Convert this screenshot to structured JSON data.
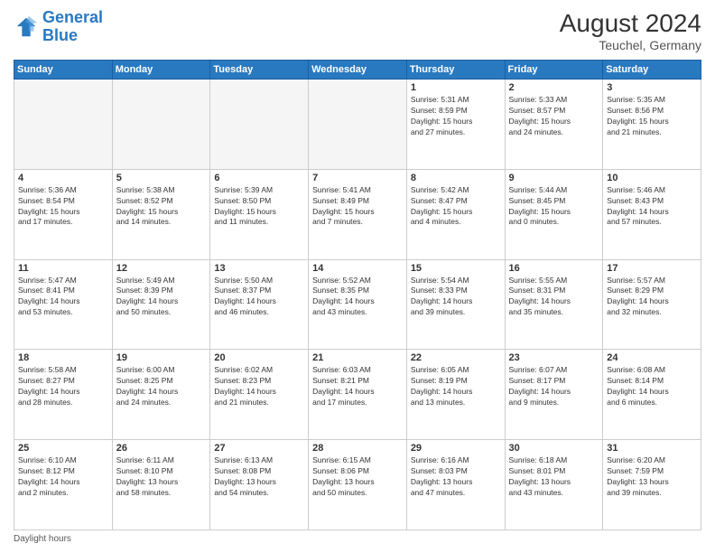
{
  "header": {
    "logo_line1": "General",
    "logo_line2": "Blue",
    "month_year": "August 2024",
    "location": "Teuchel, Germany"
  },
  "weekdays": [
    "Sunday",
    "Monday",
    "Tuesday",
    "Wednesday",
    "Thursday",
    "Friday",
    "Saturday"
  ],
  "weeks": [
    [
      {
        "day": "",
        "info": ""
      },
      {
        "day": "",
        "info": ""
      },
      {
        "day": "",
        "info": ""
      },
      {
        "day": "",
        "info": ""
      },
      {
        "day": "1",
        "info": "Sunrise: 5:31 AM\nSunset: 8:59 PM\nDaylight: 15 hours\nand 27 minutes."
      },
      {
        "day": "2",
        "info": "Sunrise: 5:33 AM\nSunset: 8:57 PM\nDaylight: 15 hours\nand 24 minutes."
      },
      {
        "day": "3",
        "info": "Sunrise: 5:35 AM\nSunset: 8:56 PM\nDaylight: 15 hours\nand 21 minutes."
      }
    ],
    [
      {
        "day": "4",
        "info": "Sunrise: 5:36 AM\nSunset: 8:54 PM\nDaylight: 15 hours\nand 17 minutes."
      },
      {
        "day": "5",
        "info": "Sunrise: 5:38 AM\nSunset: 8:52 PM\nDaylight: 15 hours\nand 14 minutes."
      },
      {
        "day": "6",
        "info": "Sunrise: 5:39 AM\nSunset: 8:50 PM\nDaylight: 15 hours\nand 11 minutes."
      },
      {
        "day": "7",
        "info": "Sunrise: 5:41 AM\nSunset: 8:49 PM\nDaylight: 15 hours\nand 7 minutes."
      },
      {
        "day": "8",
        "info": "Sunrise: 5:42 AM\nSunset: 8:47 PM\nDaylight: 15 hours\nand 4 minutes."
      },
      {
        "day": "9",
        "info": "Sunrise: 5:44 AM\nSunset: 8:45 PM\nDaylight: 15 hours\nand 0 minutes."
      },
      {
        "day": "10",
        "info": "Sunrise: 5:46 AM\nSunset: 8:43 PM\nDaylight: 14 hours\nand 57 minutes."
      }
    ],
    [
      {
        "day": "11",
        "info": "Sunrise: 5:47 AM\nSunset: 8:41 PM\nDaylight: 14 hours\nand 53 minutes."
      },
      {
        "day": "12",
        "info": "Sunrise: 5:49 AM\nSunset: 8:39 PM\nDaylight: 14 hours\nand 50 minutes."
      },
      {
        "day": "13",
        "info": "Sunrise: 5:50 AM\nSunset: 8:37 PM\nDaylight: 14 hours\nand 46 minutes."
      },
      {
        "day": "14",
        "info": "Sunrise: 5:52 AM\nSunset: 8:35 PM\nDaylight: 14 hours\nand 43 minutes."
      },
      {
        "day": "15",
        "info": "Sunrise: 5:54 AM\nSunset: 8:33 PM\nDaylight: 14 hours\nand 39 minutes."
      },
      {
        "day": "16",
        "info": "Sunrise: 5:55 AM\nSunset: 8:31 PM\nDaylight: 14 hours\nand 35 minutes."
      },
      {
        "day": "17",
        "info": "Sunrise: 5:57 AM\nSunset: 8:29 PM\nDaylight: 14 hours\nand 32 minutes."
      }
    ],
    [
      {
        "day": "18",
        "info": "Sunrise: 5:58 AM\nSunset: 8:27 PM\nDaylight: 14 hours\nand 28 minutes."
      },
      {
        "day": "19",
        "info": "Sunrise: 6:00 AM\nSunset: 8:25 PM\nDaylight: 14 hours\nand 24 minutes."
      },
      {
        "day": "20",
        "info": "Sunrise: 6:02 AM\nSunset: 8:23 PM\nDaylight: 14 hours\nand 21 minutes."
      },
      {
        "day": "21",
        "info": "Sunrise: 6:03 AM\nSunset: 8:21 PM\nDaylight: 14 hours\nand 17 minutes."
      },
      {
        "day": "22",
        "info": "Sunrise: 6:05 AM\nSunset: 8:19 PM\nDaylight: 14 hours\nand 13 minutes."
      },
      {
        "day": "23",
        "info": "Sunrise: 6:07 AM\nSunset: 8:17 PM\nDaylight: 14 hours\nand 9 minutes."
      },
      {
        "day": "24",
        "info": "Sunrise: 6:08 AM\nSunset: 8:14 PM\nDaylight: 14 hours\nand 6 minutes."
      }
    ],
    [
      {
        "day": "25",
        "info": "Sunrise: 6:10 AM\nSunset: 8:12 PM\nDaylight: 14 hours\nand 2 minutes."
      },
      {
        "day": "26",
        "info": "Sunrise: 6:11 AM\nSunset: 8:10 PM\nDaylight: 13 hours\nand 58 minutes."
      },
      {
        "day": "27",
        "info": "Sunrise: 6:13 AM\nSunset: 8:08 PM\nDaylight: 13 hours\nand 54 minutes."
      },
      {
        "day": "28",
        "info": "Sunrise: 6:15 AM\nSunset: 8:06 PM\nDaylight: 13 hours\nand 50 minutes."
      },
      {
        "day": "29",
        "info": "Sunrise: 6:16 AM\nSunset: 8:03 PM\nDaylight: 13 hours\nand 47 minutes."
      },
      {
        "day": "30",
        "info": "Sunrise: 6:18 AM\nSunset: 8:01 PM\nDaylight: 13 hours\nand 43 minutes."
      },
      {
        "day": "31",
        "info": "Sunrise: 6:20 AM\nSunset: 7:59 PM\nDaylight: 13 hours\nand 39 minutes."
      }
    ]
  ],
  "footer": "Daylight hours"
}
